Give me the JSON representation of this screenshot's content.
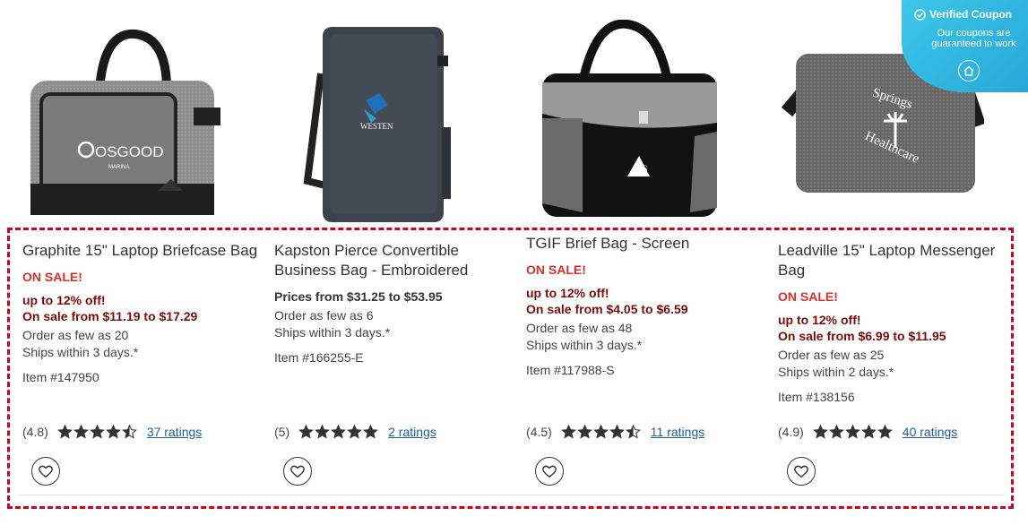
{
  "products": [
    {
      "title": "Graphite 15\" Laptop Briefcase Bag",
      "sale_label": "ON SALE!",
      "discount": "up to 12% off!",
      "sale_range": "On sale from $11.19 to $17.29",
      "min_order": "Order as few as 20",
      "ships": "Ships within 3 days.*",
      "item_no": "Item #147950",
      "rating_text": "(4.8)",
      "stars": 4.8,
      "ratings_link": "37 ratings",
      "image_logo": "OSGOOD",
      "image_sub": "MARINA"
    },
    {
      "title": "Kapston Pierce Convertible Business Bag - Embroidered",
      "prices": "Prices from $31.25 to $53.95",
      "min_order": "Order as few as 6",
      "ships": "Ships within 3 days.*",
      "item_no": "Item #166255-E",
      "rating_text": "(5)",
      "stars": 5,
      "ratings_link": "2 ratings",
      "image_logo": "WESTEN"
    },
    {
      "title": "TGIF Brief Bag - Screen",
      "sale_label": "ON SALE!",
      "discount": "up to 12% off!",
      "sale_range": "On sale from $4.05 to $6.59",
      "min_order": "Order as few as 48",
      "ships": "Ships within 3 days.*",
      "item_no": "Item #117988-S",
      "rating_text": "(4.5)",
      "stars": 4.5,
      "ratings_link": "11 ratings",
      "image_logo": "RS"
    },
    {
      "title": "Leadville 15\" Laptop Messenger Bag",
      "sale_label": "ON SALE!",
      "discount": "up to 12% off!",
      "sale_range": "On sale from $6.99 to $11.95",
      "min_order": "Order as few as 25",
      "ships": "Ships within 2 days.*",
      "item_no": "Item #138156",
      "rating_text": "(4.9)",
      "stars": 4.9,
      "ratings_link": "40 ratings",
      "image_logo_top": "Springs",
      "image_logo_bottom": "Healthcare"
    }
  ],
  "coupon": {
    "title": "Verified Coupon",
    "subtitle": "Our coupons are guaranteed to work"
  },
  "icons": {
    "heart": "heart-icon",
    "star": "star-icon",
    "check": "check-circle-icon",
    "home": "home-icon"
  },
  "colors": {
    "sale_red": "#d9302a",
    "sale_dark": "#7a0b0b",
    "link_blue": "#1f5fa8",
    "star": "#333333",
    "highlight_dash": "#d0021b",
    "coupon_bg": "#2fb6e0"
  }
}
